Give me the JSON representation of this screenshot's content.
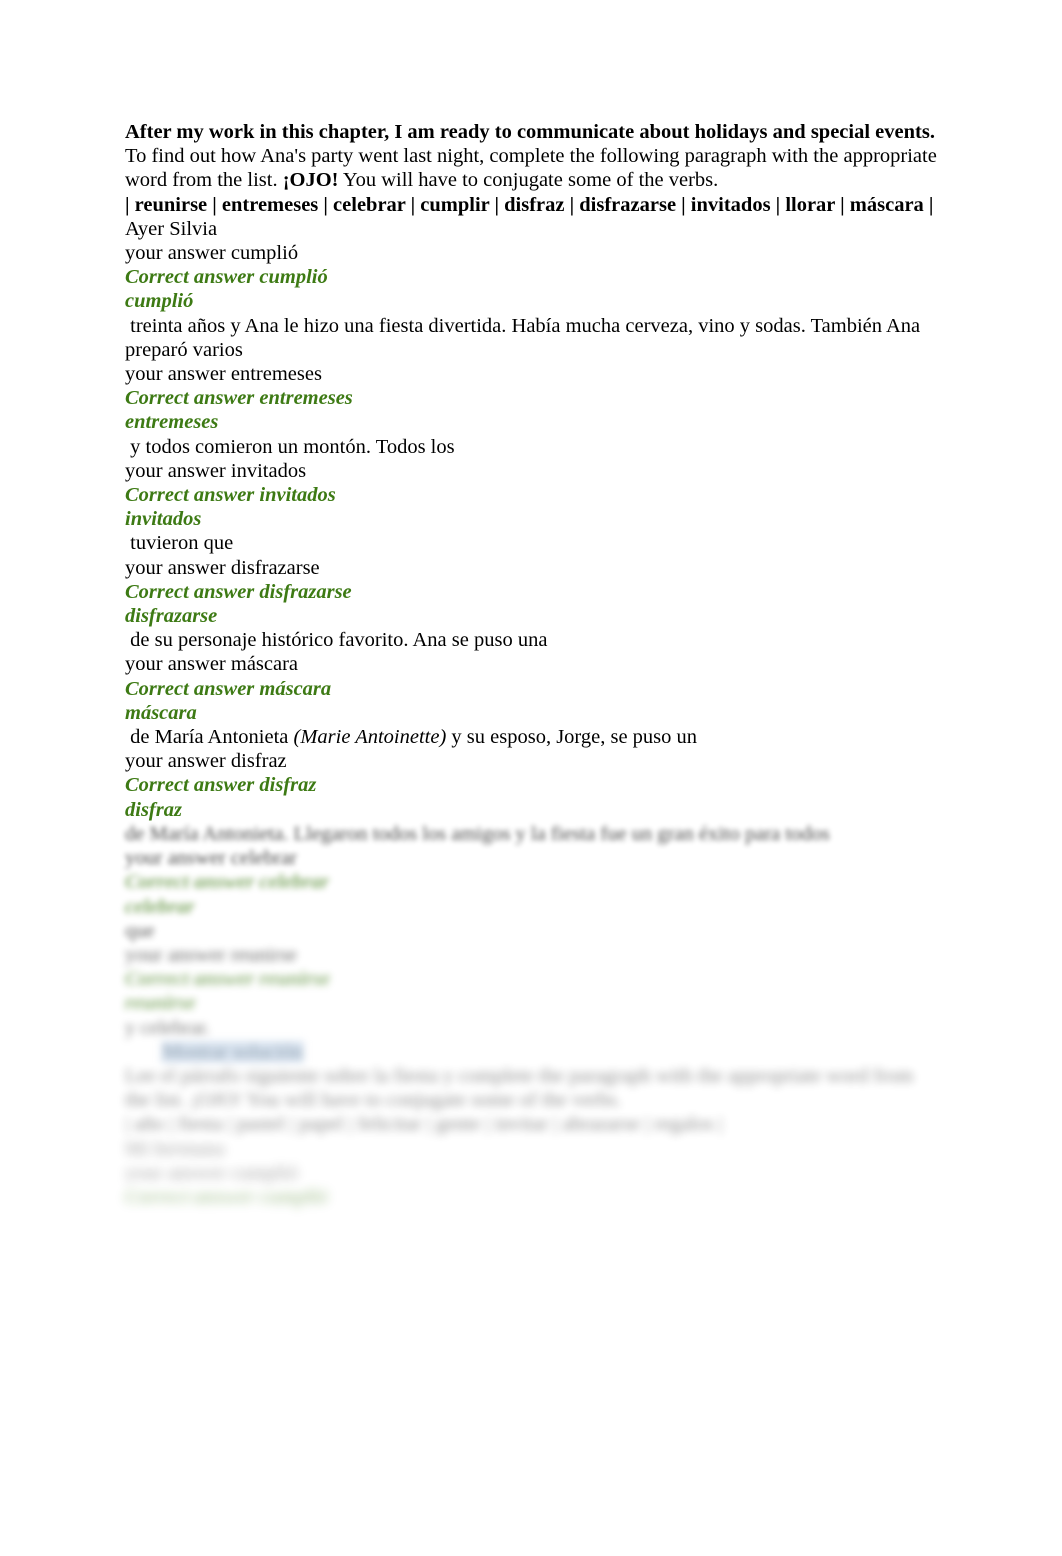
{
  "document": {
    "heading": "After my work in this chapter, I am ready to communicate about holidays and special events.",
    "instructions_part1": "To find out how Ana's party went last night, complete the following paragraph with the appropriate word from the list. ",
    "instructions_ojo": "¡OJO!",
    "instructions_part2": " You will have to conjugate some of the verbs.",
    "word_bank_line": "| reunirse | entremeses | celebrar | cumplir | disfraz | disfrazarse | invitados | llorar | máscara |",
    "word_bank": [
      "reunirse",
      "entremeses",
      "celebrar",
      "cumplir",
      "disfraz",
      "disfrazarse",
      "invitados",
      "llorar",
      "máscara"
    ],
    "labels": {
      "your_answer": "your answer",
      "correct_answer": "Correct answer"
    },
    "blanks": [
      {
        "narrative_before": "Ayer Silvia",
        "your_answer": "your answer cumplió",
        "correct_answer": "Correct answer cumplió",
        "answer_word": "cumplió",
        "narrative_after": " treinta años y Ana le hizo una fiesta divertida. Había mucha cerveza, vino y sodas. También Ana preparó varios"
      },
      {
        "your_answer": "your answer entremeses",
        "correct_answer": "Correct answer entremeses",
        "answer_word": "entremeses",
        "narrative_after": " y todos comieron un montón. Todos los"
      },
      {
        "your_answer": "your answer invitados",
        "correct_answer": "Correct answer invitados",
        "answer_word": "invitados",
        "narrative_after": " tuvieron que"
      },
      {
        "your_answer": "your answer disfrazarse",
        "correct_answer": "Correct answer disfrazarse",
        "answer_word": "disfrazarse",
        "narrative_after": " de su personaje histórico favorito. Ana se puso una"
      },
      {
        "your_answer": "your answer máscara",
        "correct_answer": "Correct answer máscara",
        "answer_word": "máscara",
        "narrative_after_pre": " de María Antonieta ",
        "narrative_after_italic": "(Marie Antoinette)",
        "narrative_after_post": " y su esposo, Jorge, se puso un"
      },
      {
        "your_answer": "your answer disfraz",
        "correct_answer": "Correct answer disfraz",
        "answer_word": "disfraz"
      }
    ],
    "blurred_tail": {
      "note": "lower portion of page is blurred and illegible",
      "lines": [
        {
          "text": "de María Antonieta. Llegaron todos los amigos y la fiesta fue un gran éxito para todos",
          "style": "narrative",
          "blur": "blur-l1"
        },
        {
          "text": "your answer celebrar",
          "style": "your-answer",
          "blur": "blur-l1"
        },
        {
          "text": "Correct answer celebrar",
          "style": "correct-answer",
          "blur": "blur-l2"
        },
        {
          "text": "celebrar",
          "style": "answer-word",
          "blur": "blur-l2"
        },
        {
          "text": "que",
          "style": "narrative",
          "blur": "blur-l2"
        },
        {
          "text": "your answer reunirse",
          "style": "your-answer",
          "blur": "blur-l3"
        },
        {
          "text": "Correct answer reunirse",
          "style": "correct-answer",
          "blur": "blur-l3"
        },
        {
          "text": "reunirse",
          "style": "answer-word",
          "blur": "blur-l3"
        },
        {
          "text": "y celebrar.",
          "style": "narrative",
          "blur": "blur-l4"
        }
      ],
      "selected_line": "Mostrar solución",
      "lines2": [
        {
          "text": "Lee el párrafo siguiente sobre la fiesta y complete the paragraph with the appropriate word from the list. ¡OJO! You will have to conjugate some of the verbs.",
          "style": "narrative",
          "blur": "blur-l5"
        },
        {
          "text": "| año | fiesta | pastel | papel | felicitar | gente | invitar | abrazarse | regalos |",
          "style": "narrative",
          "blur": "blur-l5"
        },
        {
          "text": "Mi hermana",
          "style": "narrative",
          "blur": "blur-l6"
        },
        {
          "text": "your answer cumplió",
          "style": "your-answer",
          "blur": "blur-l6"
        },
        {
          "text": "Correct answer cumplió",
          "style": "correct-answer",
          "blur": "blur-l6"
        }
      ]
    }
  }
}
